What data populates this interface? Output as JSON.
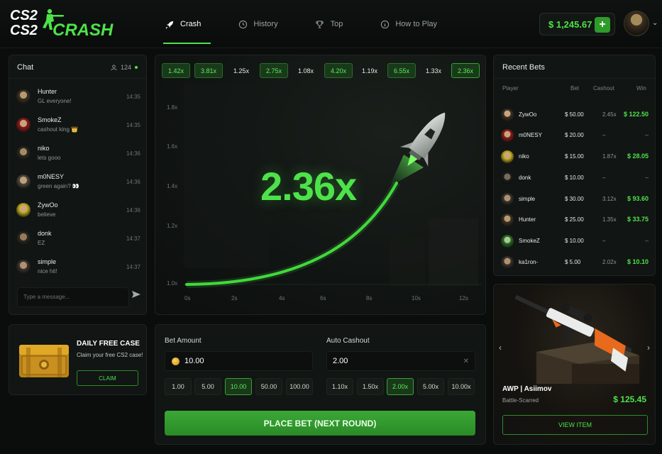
{
  "header": {
    "logo": {
      "line1": "CS2",
      "line2": "CS2",
      "word": "CRASH"
    },
    "nav": [
      {
        "label": "Crash",
        "icon": "rocket-icon",
        "active": true
      },
      {
        "label": "History",
        "icon": "history-icon",
        "active": false
      },
      {
        "label": "Top",
        "icon": "trophy-icon",
        "active": false
      },
      {
        "label": "How to Play",
        "icon": "info-icon",
        "active": false
      }
    ],
    "balance": "$ 1,245.67",
    "add_label": "+"
  },
  "chat": {
    "title": "Chat",
    "online_count": "124",
    "messages": [
      {
        "name": "Hunter",
        "text": "GL everyone!",
        "time": "14:35"
      },
      {
        "name": "SmokeZ",
        "text": "cashout king 👑",
        "time": "14:35"
      },
      {
        "name": "niko",
        "text": "lets gooo",
        "time": "14:36"
      },
      {
        "name": "m0NESY",
        "text": "green again? 👀",
        "time": "14:36"
      },
      {
        "name": "ZywOo",
        "text": "believe",
        "time": "14:36"
      },
      {
        "name": "donk",
        "text": "EZ",
        "time": "14:37"
      },
      {
        "name": "simple",
        "text": "nice hit!",
        "time": "14:37"
      }
    ],
    "input_placeholder": "Type a message..."
  },
  "daily_case": {
    "title": "DAILY FREE CASE",
    "text": "Claim your free CS2 case!",
    "button": "CLAIM"
  },
  "game": {
    "history": [
      "1.42x",
      "3.81x",
      "1.25x",
      "2.75x",
      "1.08x",
      "4.20x",
      "1.19x",
      "6.55x",
      "1.33x",
      "2.36x"
    ],
    "history_green": [
      true,
      true,
      false,
      true,
      false,
      true,
      false,
      true,
      false,
      true
    ],
    "multiplier": "2.36x",
    "y_ticks": [
      "1.8x",
      "1.6x",
      "1.4x",
      "1.2x",
      "1.0x"
    ],
    "x_ticks": [
      "0s",
      "2s",
      "4s",
      "6s",
      "8s",
      "10s",
      "12s"
    ]
  },
  "bet": {
    "amount_label": "Bet Amount",
    "amount_value": "10.00",
    "amount_chips": [
      "1.00",
      "5.00",
      "10.00",
      "50.00",
      "100.00"
    ],
    "amount_selected": "10.00",
    "cashout_label": "Auto Cashout",
    "cashout_value": "2.00",
    "cashout_chips": [
      "1.10x",
      "1.50x",
      "2.00x",
      "5.00x",
      "10.00x"
    ],
    "cashout_selected": "2.00x",
    "place_label": "PLACE BET (NEXT ROUND)"
  },
  "recent": {
    "title": "Recent Bets",
    "headers": {
      "player": "Player",
      "bet": "Bet",
      "cashout": "Cashout",
      "win": "Win"
    },
    "rows": [
      {
        "player": "ZywOo",
        "bet": "$ 50.00",
        "cashout": "2.45x",
        "win": "$ 122.50"
      },
      {
        "player": "m0NESY",
        "bet": "$ 20.00",
        "cashout": "–",
        "win": "–"
      },
      {
        "player": "niko",
        "bet": "$ 15.00",
        "cashout": "1.87x",
        "win": "$ 28.05"
      },
      {
        "player": "donk",
        "bet": "$ 10.00",
        "cashout": "–",
        "win": "–"
      },
      {
        "player": "simple",
        "bet": "$ 30.00",
        "cashout": "3.12x",
        "win": "$ 93.60"
      },
      {
        "player": "Hunter",
        "bet": "$ 25.00",
        "cashout": "1.35x",
        "win": "$ 33.75"
      },
      {
        "player": "SmokeZ",
        "bet": "$ 10.00",
        "cashout": "–",
        "win": "–"
      },
      {
        "player": "ka1ron-",
        "bet": "$ 5.00",
        "cashout": "2.02x",
        "win": "$ 10.10"
      }
    ]
  },
  "skin": {
    "name": "AWP | Asiimov",
    "condition": "Battle-Scarred",
    "price": "$ 125.45",
    "button": "VIEW ITEM",
    "prev": "‹",
    "next": "›"
  },
  "colors": {
    "accent": "#4ee24a",
    "background": "#0b0d0c",
    "panel": "#111513"
  }
}
